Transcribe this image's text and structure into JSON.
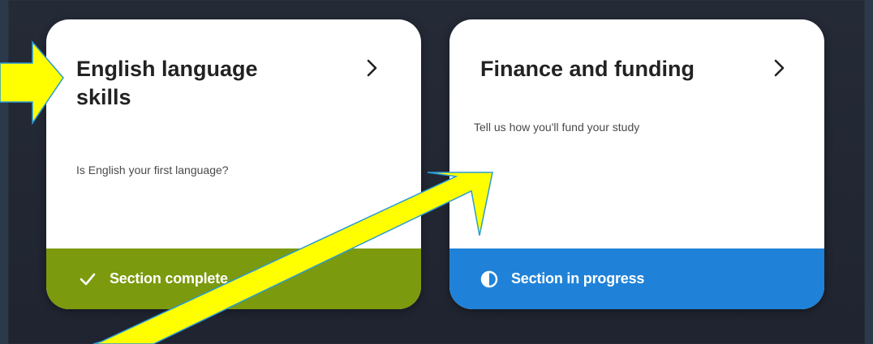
{
  "cards": [
    {
      "title": "English language skills",
      "description": "Is English your first language?",
      "status": "Section complete",
      "status_color": "#7b9a0d",
      "status_icon": "checkmark-icon",
      "nav_icon": "chevron-right-icon"
    },
    {
      "title": "Finance and funding",
      "description": "Tell us how you'll fund your study",
      "status": "Section in progress",
      "status_color": "#1f82d8",
      "status_icon": "half-circle-icon",
      "nav_icon": "chevron-right-icon"
    }
  ],
  "annotation_color": "#ffff00"
}
